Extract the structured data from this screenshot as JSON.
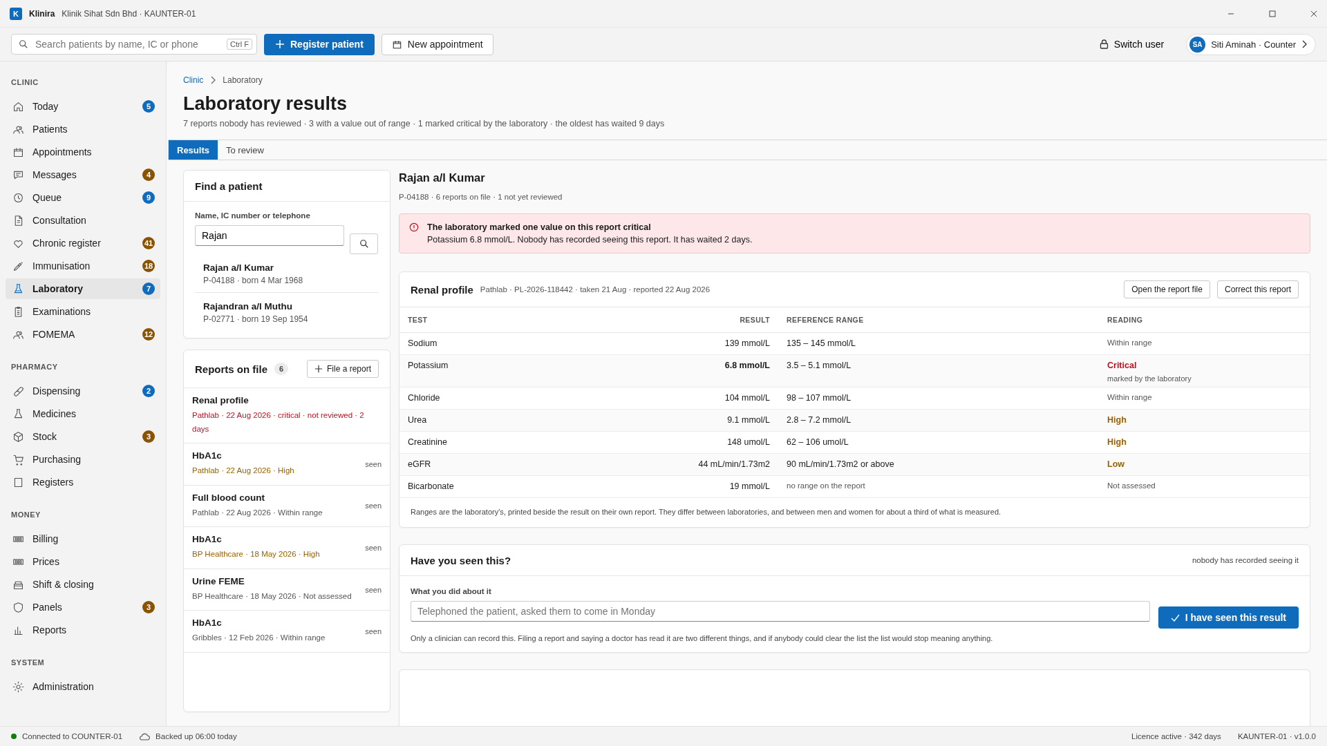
{
  "window": {
    "app": "Klinira",
    "subtitle": "Klinik Sihat Sdn Bhd · KAUNTER-01",
    "logo": "K"
  },
  "toolbar": {
    "search": {
      "placeholder": "Search patients by name, IC or phone",
      "shortcut": "Ctrl F"
    },
    "primary": "Register patient",
    "secondary": "New appointment",
    "switch_user": "Switch user",
    "user": {
      "initials": "SA",
      "label": "Siti Aminah · Counter"
    }
  },
  "sidebar": [
    {
      "heading": "CLINIC",
      "items": [
        {
          "label": "Today",
          "badge": "5",
          "color": "#0f6cbd",
          "selected": false
        },
        {
          "label": "Patients",
          "selected": false
        },
        {
          "label": "Appointments",
          "selected": false
        },
        {
          "label": "Messages",
          "badge": "4",
          "color": "#8a5300",
          "selected": false
        },
        {
          "label": "Queue",
          "badge": "9",
          "color": "#0f6cbd",
          "selected": false
        },
        {
          "label": "Consultation",
          "selected": false
        },
        {
          "label": "Chronic register",
          "badge": "41",
          "color": "#8a5300",
          "selected": false
        },
        {
          "label": "Immunisation",
          "badge": "18",
          "color": "#8a5300",
          "selected": false
        },
        {
          "label": "Laboratory",
          "badge": "7",
          "color": "#0f6cbd",
          "selected": true
        },
        {
          "label": "Examinations",
          "selected": false
        },
        {
          "label": "FOMEMA",
          "badge": "12",
          "color": "#8a5300",
          "selected": false
        }
      ]
    },
    {
      "heading": "PHARMACY",
      "items": [
        {
          "label": "Dispensing",
          "badge": "2",
          "color": "#0f6cbd",
          "selected": false
        },
        {
          "label": "Medicines",
          "selected": false
        },
        {
          "label": "Stock",
          "badge": "3",
          "color": "#8a5300",
          "selected": false
        },
        {
          "label": "Purchasing",
          "selected": false
        },
        {
          "label": "Registers",
          "selected": false
        }
      ]
    },
    {
      "heading": "MONEY",
      "items": [
        {
          "label": "Billing",
          "selected": false
        },
        {
          "label": "Prices",
          "selected": false
        },
        {
          "label": "Shift & closing",
          "selected": false
        },
        {
          "label": "Panels",
          "badge": "3",
          "color": "#8a5300",
          "selected": false
        },
        {
          "label": "Reports",
          "selected": false
        }
      ]
    },
    {
      "heading": "SYSTEM",
      "items": [
        {
          "label": "Administration",
          "selected": false
        }
      ]
    }
  ],
  "breadcrumb": [
    "Clinic",
    "Laboratory"
  ],
  "page": {
    "title": "Laboratory results",
    "summary": "7 reports nobody has reviewed · 3 with a value out of range · 1 marked critical by the laboratory · the oldest has waited 9 days"
  },
  "tabs": [
    {
      "label": "Results",
      "selected": true
    },
    {
      "label": "To review",
      "selected": false
    }
  ],
  "find_patient": {
    "title": "Find a patient",
    "field_label": "Name, IC number or telephone",
    "value": "Rajan",
    "results": [
      {
        "name": "Rajan a/l Kumar",
        "meta": "P-04188 · born 4 Mar 1968"
      },
      {
        "name": "Rajandran a/l Muthu",
        "meta": "P-02771 · born 19 Sep 1954"
      }
    ]
  },
  "reports": {
    "title": "Reports on file",
    "count": "6",
    "button": "File a report",
    "items": [
      {
        "name": "Renal profile",
        "meta": "Pathlab · 22 Aug 2026 · critical · not reviewed · 2 days",
        "kind": "critical"
      },
      {
        "name": "HbA1c",
        "meta": "Pathlab · 22 Aug 2026 · High",
        "kind": "abnormal",
        "status": "seen"
      },
      {
        "name": "Full blood count",
        "meta": "Pathlab · 22 Aug 2026 · Within range",
        "kind": "normal",
        "status": "seen"
      },
      {
        "name": "HbA1c",
        "meta": "BP Healthcare · 18 May 2026 · High",
        "kind": "abnormal",
        "status": "seen"
      },
      {
        "name": "Urine FEME",
        "meta": "BP Healthcare · 18 May 2026 · Not assessed",
        "kind": "normal",
        "status": "seen"
      },
      {
        "name": "HbA1c",
        "meta": "Gribbles · 12 Feb 2026 · Within range",
        "kind": "normal",
        "status": "seen"
      }
    ]
  },
  "patient": {
    "name": "Rajan a/l Kumar",
    "meta": "P-04188 · 6 reports on file · 1 not yet reviewed"
  },
  "alert": {
    "title": "The laboratory marked one value on this report critical",
    "text": "Potassium 6.8 mmol/L. Nobody has recorded seeing this report. It has waited 2 days."
  },
  "report": {
    "title": "Renal profile",
    "meta": "Pathlab · PL-2026-118442 · taken 21 Aug · reported 22 Aug 2026",
    "buttons": [
      "Open the report file",
      "Correct this report"
    ],
    "columns": [
      "TEST",
      "RESULT",
      "REFERENCE RANGE",
      "READING"
    ],
    "rows": [
      {
        "test": "Sodium",
        "result": "139 mmol/L",
        "range": "135 – 145 mmol/L",
        "reading": "Within range",
        "kind": "normal"
      },
      {
        "test": "Potassium",
        "result": "6.8 mmol/L",
        "range": "3.5 – 5.1 mmol/L",
        "reading": "Critical",
        "note": "marked by the laboratory",
        "kind": "critical"
      },
      {
        "test": "Chloride",
        "result": "104 mmol/L",
        "range": "98 – 107 mmol/L",
        "reading": "Within range",
        "kind": "normal"
      },
      {
        "test": "Urea",
        "result": "9.1 mmol/L",
        "range": "2.8 – 7.2 mmol/L",
        "reading": "High",
        "kind": "abnormal"
      },
      {
        "test": "Creatinine",
        "result": "148 umol/L",
        "range": "62 – 106 umol/L",
        "reading": "High",
        "kind": "abnormal"
      },
      {
        "test": "eGFR",
        "result": "44 mL/min/1.73m2",
        "range": "90 mL/min/1.73m2 or above",
        "reading": "Low",
        "kind": "abnormal"
      },
      {
        "test": "Bicarbonate",
        "result": "19 mmol/L",
        "range": "no range on the report",
        "reading": "Not assessed",
        "kind": "none"
      }
    ],
    "footnote": "Ranges are the laboratory's, printed beside the result on their own report. They differ between laboratories, and between men and women for about a third of what is measured."
  },
  "review": {
    "title": "Have you seen this?",
    "status": "nobody has recorded seeing it",
    "field_label": "What you did about it",
    "placeholder": "Telephoned the patient, asked them to come in Monday",
    "button": "I have seen this result",
    "note": "Only a clinician can record this. Filing a report and saying a doctor has read it are two different things, and if anybody could clear the list the list would stop meaning anything."
  },
  "status_bar": {
    "connection": "Connected to COUNTER-01",
    "backup": "Backed up 06:00 today",
    "licence": "Licence active · 342 days",
    "version": "KAUNTER-01 · v1.0.0"
  }
}
